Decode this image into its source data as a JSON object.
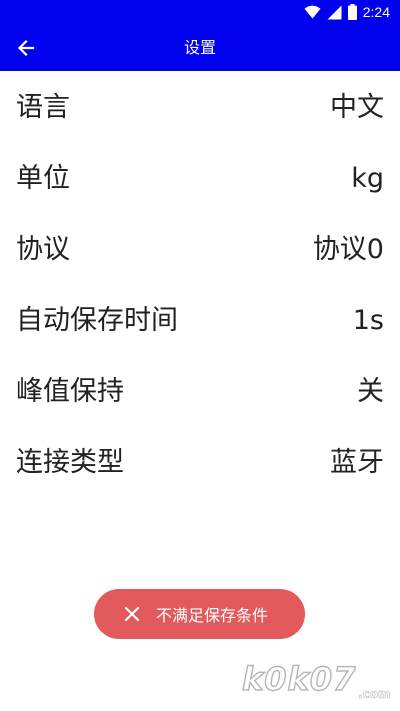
{
  "status_bar": {
    "time": "2:24",
    "icons": [
      "wifi-icon",
      "signal-icon",
      "battery-icon"
    ]
  },
  "app_bar": {
    "title": "设置",
    "back_icon": "arrow-left-icon",
    "background_color": "#0000ee"
  },
  "settings": [
    {
      "label": "语言",
      "value": "中文"
    },
    {
      "label": "单位",
      "value": "kg"
    },
    {
      "label": "协议",
      "value": "协议0"
    },
    {
      "label": "自动保存时间",
      "value": "1s"
    },
    {
      "label": "峰值保持",
      "value": "关"
    },
    {
      "label": "连接类型",
      "value": "蓝牙"
    }
  ],
  "toast": {
    "text": "不满足保存条件",
    "icon": "close-icon",
    "background_color": "#e35a5d"
  },
  "watermark": {
    "text": "k0k07.com"
  }
}
